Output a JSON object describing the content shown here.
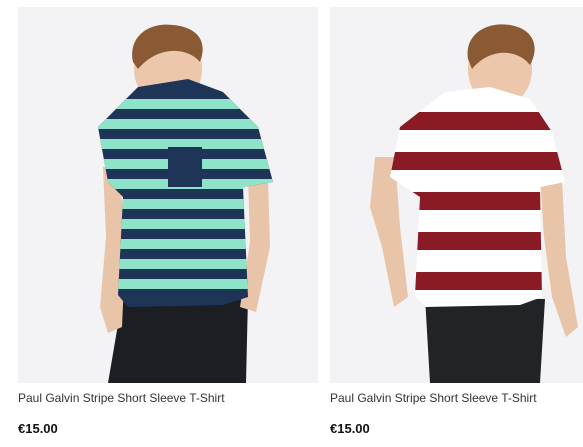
{
  "products": [
    {
      "title": "Paul Galvin Stripe Short Sleeve T-Shirt",
      "price": "€15.00",
      "stripe_colors": [
        "#1e3557",
        "#8fe3c9"
      ]
    },
    {
      "title": "Paul Galvin Stripe Short Sleeve T-Shirt",
      "price": "€15.00",
      "stripe_colors": [
        "#8a1a24",
        "#ffffff"
      ]
    }
  ]
}
